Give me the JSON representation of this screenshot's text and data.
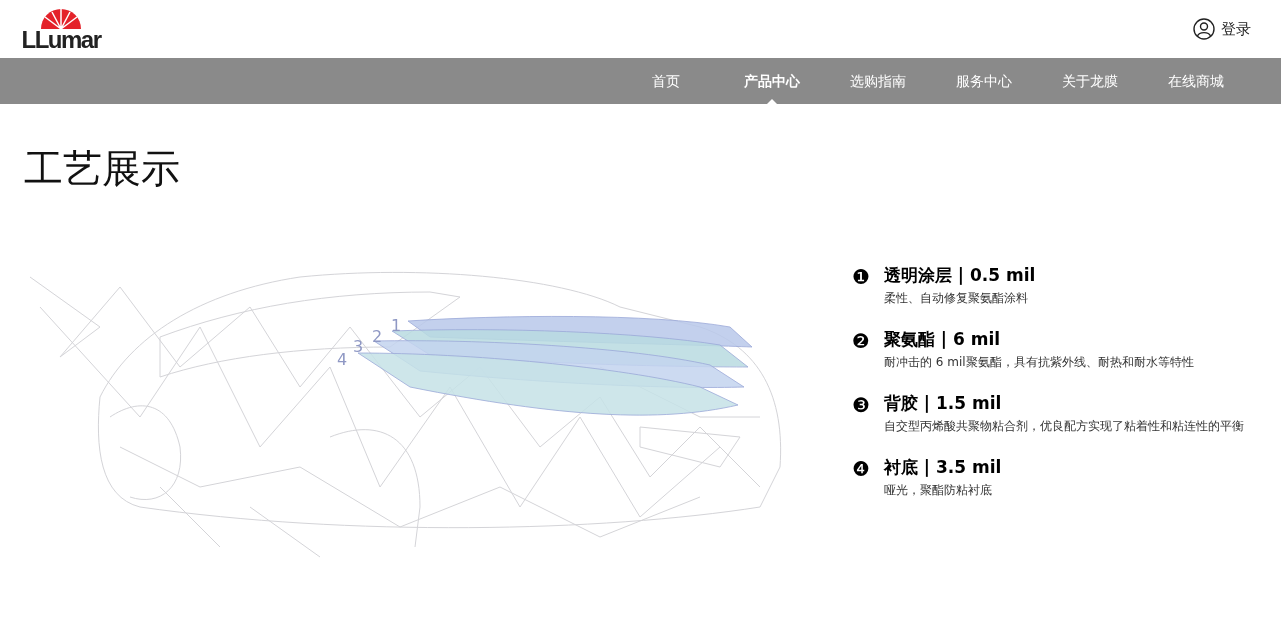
{
  "header": {
    "logo": "LLumar",
    "login": "登录"
  },
  "nav": [
    {
      "label": "首页",
      "selected": false
    },
    {
      "label": "产品中心",
      "selected": true
    },
    {
      "label": "选购指南",
      "selected": false
    },
    {
      "label": "服务中心",
      "selected": false
    },
    {
      "label": "关于龙膜",
      "selected": false
    },
    {
      "label": "在线商城",
      "selected": false
    }
  ],
  "page_title": "工艺展示",
  "illustration": {
    "layer_numbers": [
      "1",
      "2",
      "3",
      "4"
    ]
  },
  "layers": [
    {
      "marker": "❶",
      "title": "透明涂层 | 0.5 mil",
      "description": "柔性、自动修复聚氨酯涂料"
    },
    {
      "marker": "❷",
      "title": "聚氨酯 | 6 mil",
      "description": "耐冲击的 6 mil聚氨酯，具有抗紫外线、耐热和耐水等特性"
    },
    {
      "marker": "❸",
      "title": "背胶 | 1.5 mil",
      "description": "自交型丙烯酸共聚物粘合剂，优良配方实现了粘着性和粘连性的平衡"
    },
    {
      "marker": "❹",
      "title": "衬底 | 3.5 mil",
      "description": "哑光，聚酯防粘衬底"
    }
  ]
}
